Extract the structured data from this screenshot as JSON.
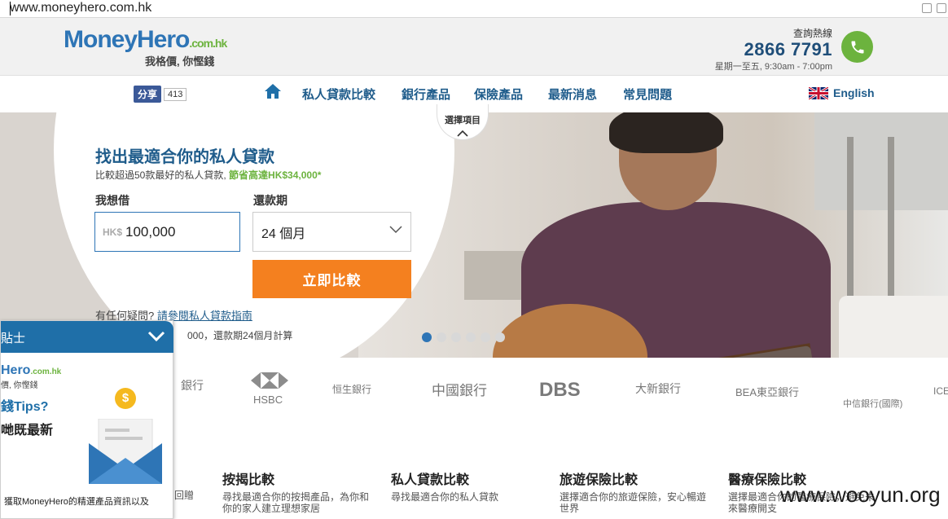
{
  "browser": {
    "url": "www.moneyhero.com.hk"
  },
  "header": {
    "logo_brand": "MoneyHero",
    "logo_domain": ".com.hk",
    "logo_slogan": "我格價, 你慳錢",
    "hotline_label": "查詢熱線",
    "hotline_number": "2866 7791",
    "hotline_hours": "星期一至五, 9:30am - 7:00pm"
  },
  "nav": {
    "share_label": "分享",
    "share_count": "413",
    "items": [
      "私人貸款比較",
      "銀行產品",
      "保險產品",
      "最新消息",
      "常見問題"
    ],
    "language": "English"
  },
  "hero": {
    "title": "找出最適合你的私人貸款",
    "subtitle_prefix": "比較超過50款最好的私人貸款, ",
    "subtitle_highlight": "節省高達HK$34,000*",
    "amount_label": "我想借",
    "amount_currency": "HK$",
    "amount_value": "100,000",
    "term_label": "還款期",
    "term_value": "24 個月",
    "compare_button": "立即比較",
    "faq_prefix": "有任何疑問? ",
    "faq_link": "請參閱私人貸款指南",
    "note": "000，還款期24個月計算",
    "tab_label": "選擇項目",
    "slides": 6,
    "active_slide": 1
  },
  "banks": [
    "銀行",
    "HSBC",
    "恒生銀行",
    "中國銀行",
    "DBS",
    "大新銀行",
    "BEA東亞銀行",
    "中信銀行(國際)",
    "ICE"
  ],
  "products": [
    {
      "title": "按揭比較",
      "desc": "尋找最適合你的按揭產品，為你和你的家人建立理想家居"
    },
    {
      "title": "私人貸款比較",
      "desc": "尋找最適合你的私人貸款"
    },
    {
      "title": "旅遊保險比較",
      "desc": "選擇適合你的旅遊保險，安心暢遊世界"
    },
    {
      "title": "醫療保險比較",
      "desc": "選擇最適合你的醫療保險，避免未來醫療開支"
    }
  ],
  "products_partial_left": "回贈",
  "popup": {
    "title": "貼士",
    "brand": "Hero",
    "brand_domain": ".com.hk",
    "slogan": "價, 你慳錢",
    "tips": "錢Tips?",
    "new": "哋既最新",
    "footer": "獲取MoneyHero的精選產品資訊以及"
  },
  "watermark": "www.wooyun.org",
  "colors": {
    "brand_blue": "#2e75b6",
    "nav_blue": "#1f5c8b",
    "green": "#6cb33e",
    "orange": "#f4801f"
  }
}
